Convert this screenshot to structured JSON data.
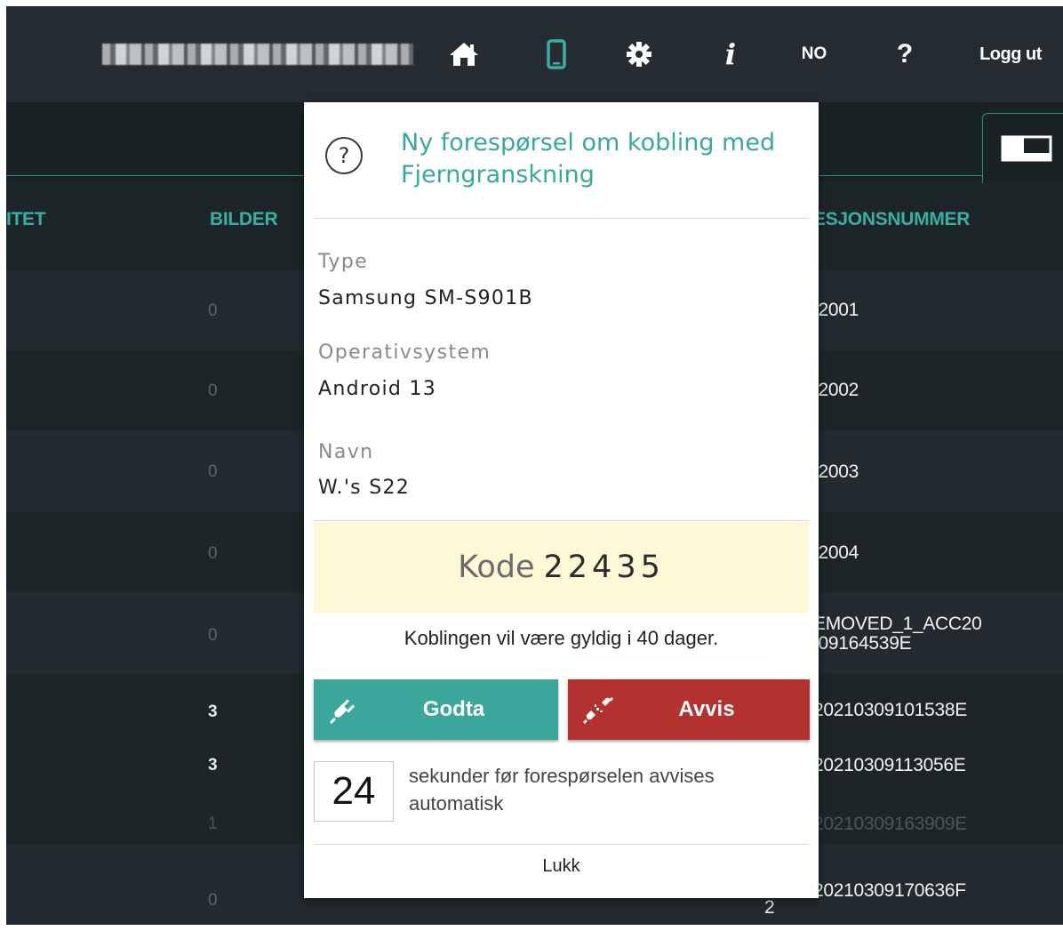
{
  "topbar": {
    "language": "NO",
    "help": "?",
    "info": "i",
    "logout": "Logg ut"
  },
  "table": {
    "headers": {
      "col1": "ITET",
      "bilder": "BILDER",
      "sesjon": "ESJONSNUMMER"
    },
    "rows": [
      {
        "bilder": "0",
        "sesjon": "!2001"
      },
      {
        "bilder": "0",
        "sesjon": "!2002"
      },
      {
        "bilder": "0",
        "sesjon": "!2003"
      },
      {
        "bilder": "0",
        "sesjon": "!2004"
      },
      {
        "bilder": "0",
        "sesjon_line1": "EMOVED_1_ACC20",
        "sesjon_line2": "!09164539E"
      },
      {
        "bilder": "3",
        "sesjon": "20210309101538E"
      },
      {
        "bilder": "3",
        "sesjon": "20210309113056E"
      },
      {
        "bilder": "1",
        "sesjon": "20210309163909E"
      },
      {
        "bilder": "0",
        "sesjon": "20210309170636F",
        "extra": "2"
      }
    ]
  },
  "modal": {
    "title": "Ny forespørsel om kobling med Fjerngranskning",
    "type_label": "Type",
    "type_value": "Samsung SM-S901B",
    "os_label": "Operativsystem",
    "os_value": "Android 13",
    "name_label": "Navn",
    "name_value": "W.'s S22",
    "code_label": "Kode",
    "code_value": "22435",
    "validity": "Koblingen vil være gyldig i 40 dager.",
    "accept_label": "Godta",
    "reject_label": "Avvis",
    "countdown_seconds": "24",
    "countdown_text": "sekunder før forespørselen avvises automatisk",
    "close_label": "Lukk"
  },
  "colors": {
    "accent": "#37b0a3",
    "accept": "#3ba79a",
    "reject": "#b3322f",
    "code_bg": "#fdf8d5",
    "background": "#1e2529"
  },
  "icons": [
    "home-icon",
    "mobile-device-icon",
    "gear-icon",
    "info-icon",
    "help-icon",
    "layout-icon",
    "question-circle-icon",
    "plug-connect-icon",
    "plug-disconnect-icon"
  ]
}
